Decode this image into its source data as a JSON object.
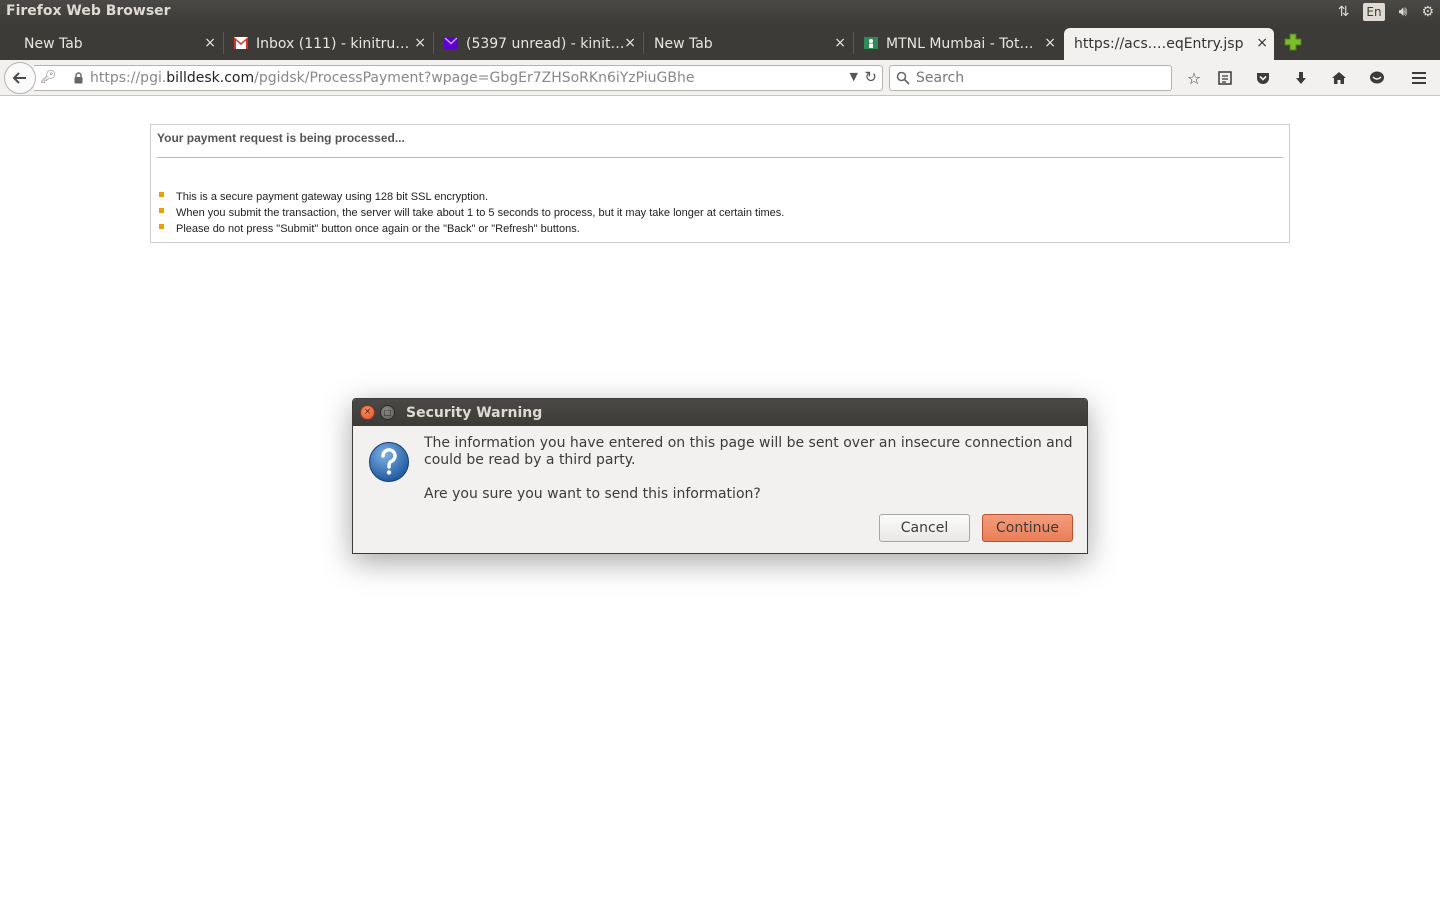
{
  "system": {
    "app_title": "Firefox Web Browser",
    "lang_indicator": "En"
  },
  "tabs": [
    {
      "label": "New Tab",
      "icon": "none",
      "active": false
    },
    {
      "label": "Inbox (111) - kinitru…",
      "icon": "gmail-icon",
      "active": false
    },
    {
      "label": "(5397 unread) - kinit…",
      "icon": "yahoo-mail-icon",
      "active": false
    },
    {
      "label": "New Tab",
      "icon": "none",
      "active": false
    },
    {
      "label": "MTNL Mumbai - Tot…",
      "icon": "mtnl-icon",
      "active": false
    },
    {
      "label": "https://acs.…eqEntry.jsp",
      "icon": "none",
      "active": true
    }
  ],
  "tab_close_glyph": "×",
  "navbar": {
    "url_prefix": "https://pgi.",
    "url_domain": "billdesk.com",
    "url_path": "/pgidsk/ProcessPayment?wpage=GbgEr7ZHSoRKn6iYzPiuGBhe",
    "search_placeholder": "Search"
  },
  "page": {
    "processing_title": "Your payment request is being processed...",
    "notes": [
      "This is a secure payment gateway using 128 bit SSL encryption.",
      "When you submit the transaction, the server will take about 1 to 5 seconds to process, but it may take longer at certain times.",
      "Please do not press \"Submit\" button once again or the \"Back\" or \"Refresh\" buttons."
    ]
  },
  "dialog": {
    "title": "Security Warning",
    "message": "The information you have entered on this page will be sent over an insecure connection and could be read by a third party.",
    "question": "Are you sure you want to send this information?",
    "cancel_label": "Cancel",
    "continue_label": "Continue"
  },
  "colors": {
    "panel_dark": "#3c3b37",
    "accent_orange": "#e97e58",
    "bullet_orange": "#e8a100"
  }
}
